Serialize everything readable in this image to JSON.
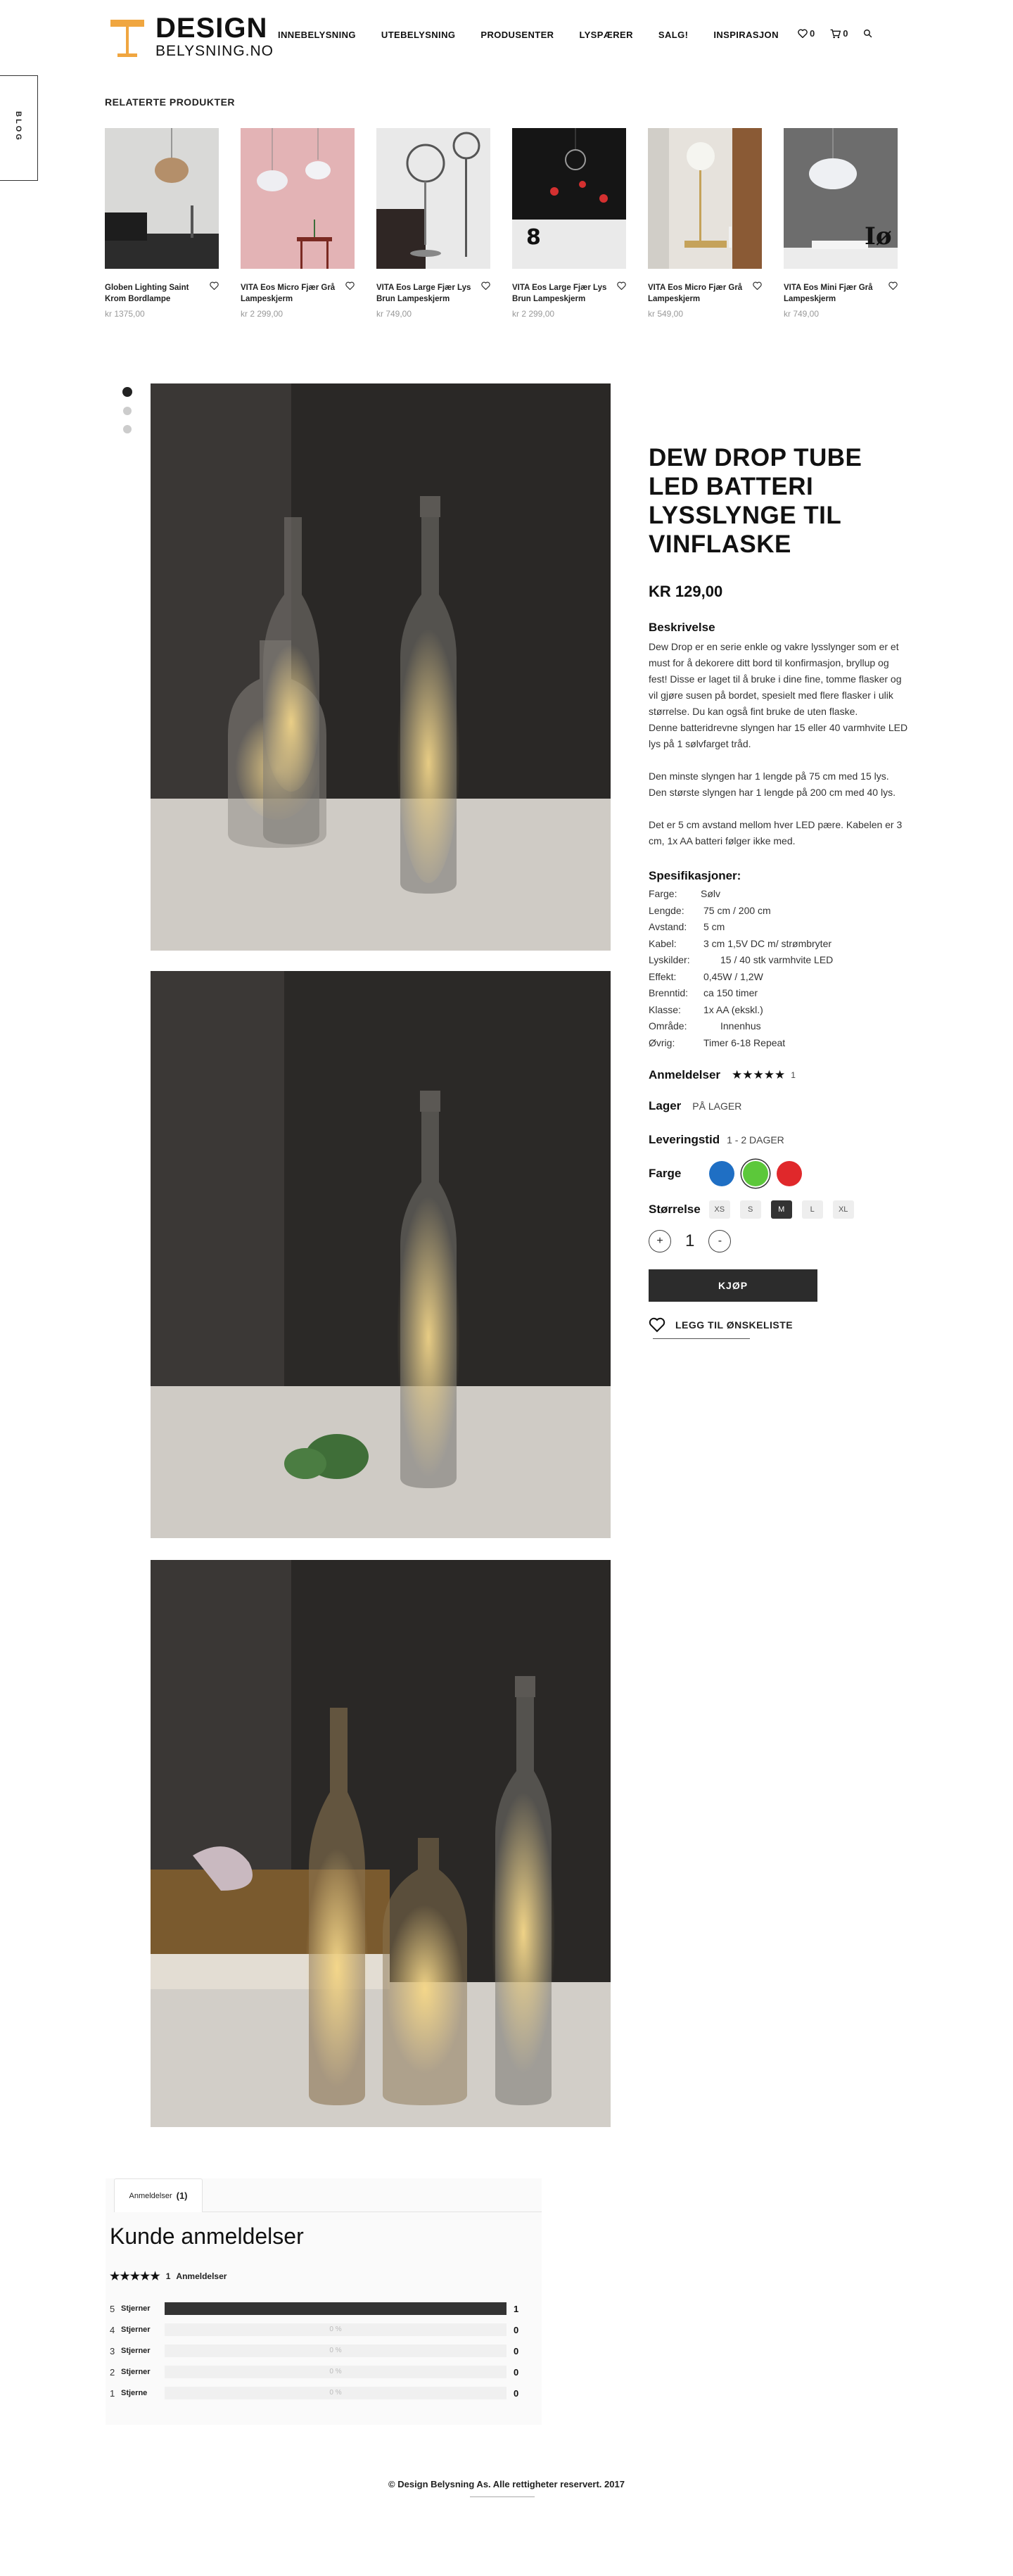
{
  "header": {
    "logo_line1": "DESIGN",
    "logo_line2": "BELYSNING.NO",
    "nav": [
      "INNEBELYSNING",
      "UTEBELYSNING",
      "PRODUSENTER",
      "LYSPÆRER",
      "SALG!",
      "INSPIRASJON"
    ],
    "wishlist_count": "0",
    "cart_count": "0"
  },
  "blog_tab": "BLOG",
  "related": {
    "title": "RELATERTE PRODUKTER",
    "items": [
      {
        "name": "Globen Lighting Saint Krom Bordlampe",
        "price": "kr 1375,00"
      },
      {
        "name": "VITA Eos Micro Fjær Grå Lampeskjerm",
        "price": "kr 2 299,00"
      },
      {
        "name": "VITA Eos Large Fjær Lys Brun Lampeskjerm",
        "price": "kr 749,00"
      },
      {
        "name": "VITA Eos Large Fjær Lys Brun Lampeskjerm",
        "price": "kr 2 299,00"
      },
      {
        "name": "VITA Eos Micro Fjær Grå Lampeskjerm",
        "price": "kr 549,00"
      },
      {
        "name": "VITA Eos Mini Fjær Grå Lampeskjerm",
        "price": "kr 749,00"
      }
    ]
  },
  "product": {
    "title": "DEW DROP TUBE LED BATTERI LYSSLYNGE TIL VINFLASKE",
    "price": "KR 129,00",
    "desc_heading": "Beskrivelse",
    "description": "Dew Drop er en serie enkle og vakre lysslynger som er et must for å dekorere ditt bord til konfirmasjon, bryllup og fest! Disse er laget til å bruke i dine fine, tomme flasker og vil gjøre susen på bordet, spesielt med flere flasker i ulik størrelse. Du kan også fint bruke de uten flaske.\nDenne batteridrevne slyngen har 15 eller 40 varmhvite LED lys på 1 sølvfarget tråd.\n\nDen minste slyngen har 1 lengde på 75 cm med 15 lys.\nDen største slyngen har 1 lengde på 200 cm med 40 lys.\n\nDet er 5 cm avstand mellom hver LED pære. Kabelen er 3 cm, 1x AA batteri følger ikke med.",
    "spec_heading": "Spesifikasjoner:",
    "specs": [
      {
        "k": "Farge:",
        "v": "Sølv"
      },
      {
        "k": "Lengde:",
        "v": "75 cm / 200 cm"
      },
      {
        "k": "Avstand:",
        "v": "5 cm"
      },
      {
        "k": "Kabel:",
        "v": "3 cm 1,5V DC m/ strømbryter"
      },
      {
        "k": "Lyskilder:",
        "v": "15 / 40 stk varmhvite LED"
      },
      {
        "k": "Effekt:",
        "v": "0,45W / 1,2W"
      },
      {
        "k": "Brenntid:",
        "v": "ca 150 timer"
      },
      {
        "k": "Klasse:",
        "v": "1x AA (ekskl.)"
      },
      {
        "k": "Område:",
        "v": "Innenhus"
      },
      {
        "k": "Øvrig:",
        "v": "Timer 6-18 Repeat"
      }
    ],
    "reviews_label": "Anmeldelser",
    "reviews_stars": "★★★★★",
    "reviews_count": "1",
    "stock_label": "Lager",
    "stock_value": "PÅ LAGER",
    "delivery_label": "Leveringstid",
    "delivery_value": "1 - 2 DAGER",
    "color_label": "Farge",
    "colors": [
      "#1f6fc4",
      "#5cc83a",
      "#e0282b"
    ],
    "size_label": "Størrelse",
    "sizes": [
      "XS",
      "S",
      "M",
      "L",
      "XL"
    ],
    "selected_size": "M",
    "qty_plus": "+",
    "qty": "1",
    "qty_minus": "-",
    "buy_label": "KJØP",
    "wishlist_label": "LEGG TIL ØNSKELISTE"
  },
  "reviews": {
    "tab_label": "Anmeldelser",
    "tab_count": "(1)",
    "heading": "Kunde anmeldelser",
    "summary_stars": "★★★★★",
    "summary_count": "1",
    "summary_label": "Anmeldelser",
    "rows": [
      {
        "n": "5",
        "label": "Stjerner",
        "fraction": 1.0,
        "pct": "",
        "count": "1"
      },
      {
        "n": "4",
        "label": "Stjerner",
        "fraction": 0,
        "pct": "0 %",
        "count": "0"
      },
      {
        "n": "3",
        "label": "Stjerner",
        "fraction": 0,
        "pct": "0 %",
        "count": "0"
      },
      {
        "n": "2",
        "label": "Stjerner",
        "fraction": 0,
        "pct": "0 %",
        "count": "0"
      },
      {
        "n": "1",
        "label": "Stjerne",
        "fraction": 0,
        "pct": "0 %",
        "count": "0"
      }
    ]
  },
  "footer": "© Design Belysning As. Alle rettigheter reservert. 2017"
}
